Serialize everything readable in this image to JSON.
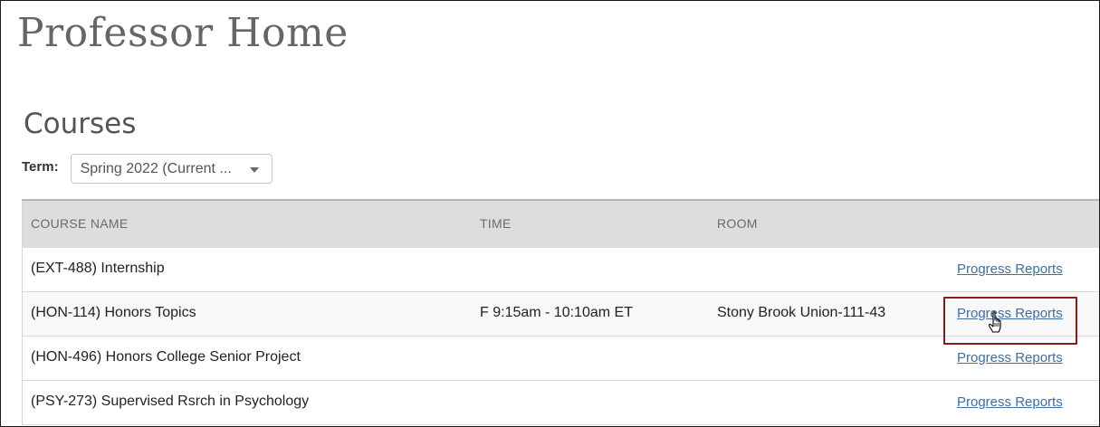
{
  "page": {
    "title": "Professor Home"
  },
  "courses": {
    "section_title": "Courses",
    "term_label": "Term:",
    "term_selected": "Spring 2022 (Current ...",
    "columns": [
      "COURSE NAME",
      "TIME",
      "ROOM",
      ""
    ],
    "rows": [
      {
        "name": "(EXT-488) Internship",
        "time": "",
        "room": "",
        "link": "Progress Reports"
      },
      {
        "name": "(HON-114) Honors Topics",
        "time": "F 9:15am - 10:10am ET",
        "room": "Stony Brook Union-111-43",
        "link": "Progress Reports"
      },
      {
        "name": "(HON-496) Honors College Senior Project",
        "time": "",
        "room": "",
        "link": "Progress Reports"
      },
      {
        "name": "(PSY-273) Supervised Rsrch in Psychology",
        "time": "",
        "room": "",
        "link": "Progress Reports"
      }
    ]
  },
  "annotation": {
    "highlight_color": "#8b1a1a"
  },
  "icons": {
    "caret": "chevron-down-icon",
    "cursor": "hand-pointer-cursor-icon"
  },
  "colors": {
    "link": "#3b6fa6",
    "header_bg": "#dddddd"
  }
}
